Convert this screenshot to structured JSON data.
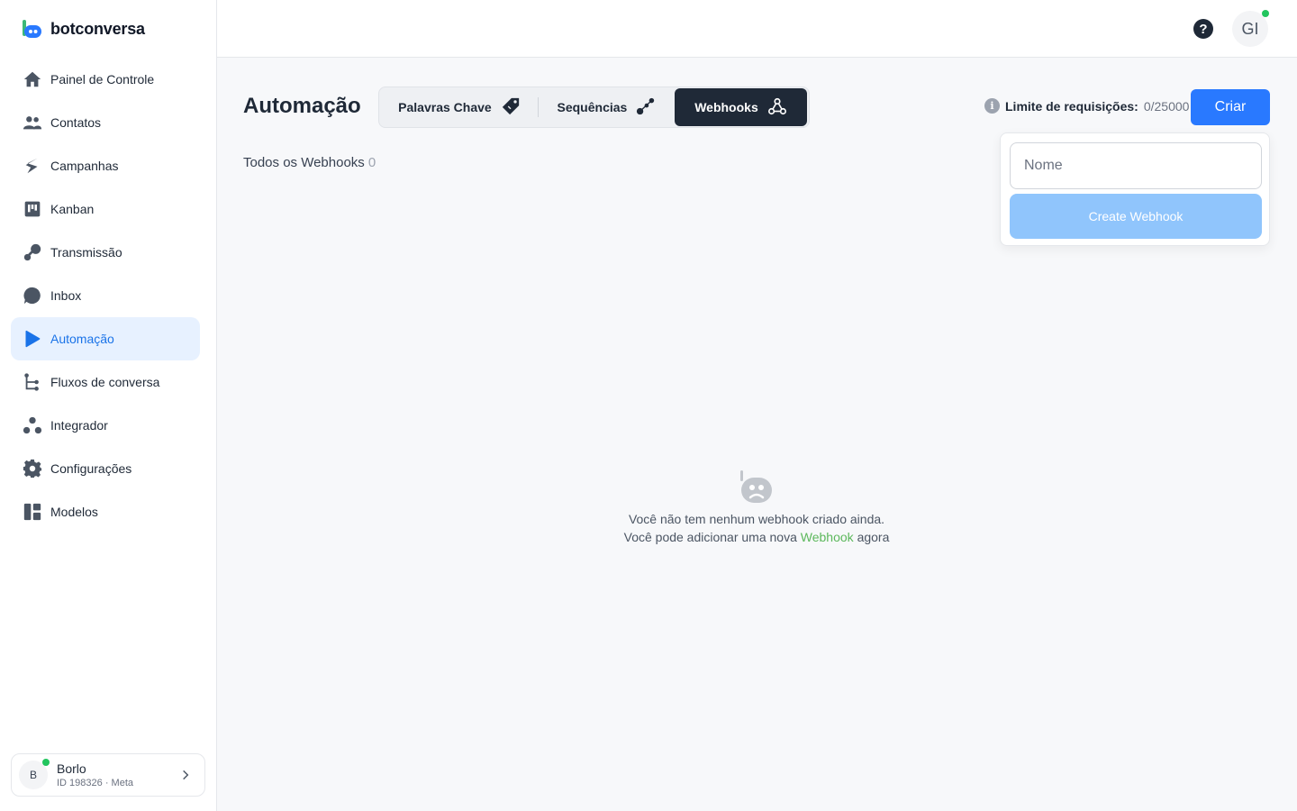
{
  "brand": {
    "name": "botconversa"
  },
  "sidebar": {
    "items": [
      {
        "label": "Painel de Controle",
        "icon": "home-icon"
      },
      {
        "label": "Contatos",
        "icon": "users-icon"
      },
      {
        "label": "Campanhas",
        "icon": "campaign-icon"
      },
      {
        "label": "Kanban",
        "icon": "kanban-icon"
      },
      {
        "label": "Transmissão",
        "icon": "broadcast-icon"
      },
      {
        "label": "Inbox",
        "icon": "chat-bubble-icon"
      },
      {
        "label": "Automação",
        "icon": "play-icon",
        "active": true
      },
      {
        "label": "Fluxos de conversa",
        "icon": "flow-icon"
      },
      {
        "label": "Integrador",
        "icon": "integrator-icon"
      },
      {
        "label": "Configurações",
        "icon": "gear-icon"
      },
      {
        "label": "Modelos",
        "icon": "templates-icon"
      }
    ],
    "account": {
      "initial": "B",
      "name": "Borlo",
      "sub": "ID 198326 · Meta"
    }
  },
  "topbar": {
    "help": "?",
    "user_initials": "GI"
  },
  "main": {
    "title": "Automação",
    "tabs": [
      {
        "label": "Palavras Chave",
        "icon": "tag-icon"
      },
      {
        "label": "Sequências",
        "icon": "sequence-icon"
      },
      {
        "label": "Webhooks",
        "icon": "webhook-icon",
        "active": true
      }
    ],
    "limit": {
      "label": "Limite de requisições:",
      "value": "0/25000"
    },
    "create_label": "Criar",
    "section": {
      "title": "Todos os Webhooks",
      "count": "0"
    },
    "popover": {
      "placeholder": "Nome",
      "button": "Create Webhook"
    },
    "empty": {
      "line1": "Você não tem nenhum webhook criado ainda.",
      "line2_prefix": "Você pode adicionar uma nova",
      "line2_link": "Webhook",
      "line2_suffix": "agora"
    }
  },
  "colors": {
    "accent": "#2979ff",
    "active_bg": "#e7f1ff",
    "active_text": "#1a73e8",
    "dark_tab": "#1f2937",
    "online": "#22c55e",
    "link": "#5cb85c"
  }
}
